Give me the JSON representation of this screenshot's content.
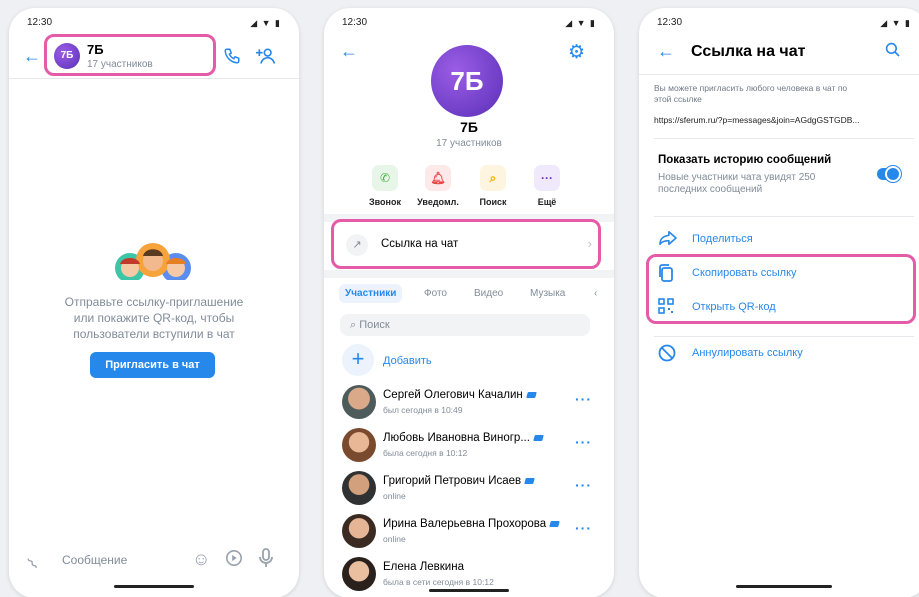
{
  "status_time": "12:30",
  "screen1": {
    "avatar_text": "7Б",
    "chat_title": "7Б",
    "chat_subtitle": "17 участников",
    "empty_text_line1": "Отправьте ссылку-приглашение",
    "empty_text_line2": "или покажите QR-код, чтобы",
    "empty_text_line3": "пользователи вступили в чат",
    "invite_button": "Пригласить в чат",
    "message_placeholder": "Сообщение"
  },
  "screen2": {
    "avatar_text": "7Б",
    "name": "7Б",
    "members_count": "17 участников",
    "actions": [
      {
        "label": "Звонок",
        "icon": "phone-icon",
        "bg": "#e8f6e9",
        "color": "#4bb34b"
      },
      {
        "label": "Уведомл.",
        "icon": "bell-icon",
        "bg": "#fde8ea",
        "color": "#e64646"
      },
      {
        "label": "Поиск",
        "icon": "search-icon",
        "bg": "#fdf5df",
        "color": "#f0b000"
      },
      {
        "label": "Ещё",
        "icon": "more-icon",
        "bg": "#efe9fb",
        "color": "#792ec0"
      }
    ],
    "chat_link_label": "Ссылка на чат",
    "tabs": [
      "Участники",
      "Фото",
      "Видео",
      "Музыка"
    ],
    "search_placeholder": "Поиск",
    "add_label": "Добавить",
    "members": [
      {
        "name": "Сергей Олегович Качалин",
        "status": "был сегодня в 10:49",
        "badge": true
      },
      {
        "name": "Любовь Ивановна Виногр...",
        "status": "была сегодня в 10:12",
        "badge": true
      },
      {
        "name": "Григорий Петрович Исаев",
        "status": "online",
        "badge": true
      },
      {
        "name": "Ирина Валерьевна Прохорова",
        "status": "online",
        "badge": true
      },
      {
        "name": "Елена Левкина",
        "status": "была в сети сегодня в 10:12",
        "badge": false
      }
    ]
  },
  "screen3": {
    "title": "Ссылка на чат",
    "hint_line1": "Вы можете пригласить любого человека в чат по",
    "hint_line2": "этой ссылке",
    "url": "https://sferum.ru/?p=messages&join=AGdgGSTGDB...",
    "history_title": "Показать историю сообщений",
    "history_sub_line1": "Новые участники чата увидят 250",
    "history_sub_line2": "последних сообщений",
    "history_enabled": true,
    "share_label": "Поделиться",
    "copy_label": "Скопировать ссылку",
    "qr_label": "Открыть QR-код",
    "revoke_label": "Аннулировать ссылку"
  },
  "colors": {
    "accent": "#2688eb",
    "highlight": "#e45ba8",
    "secondary_text": "#818c99"
  }
}
